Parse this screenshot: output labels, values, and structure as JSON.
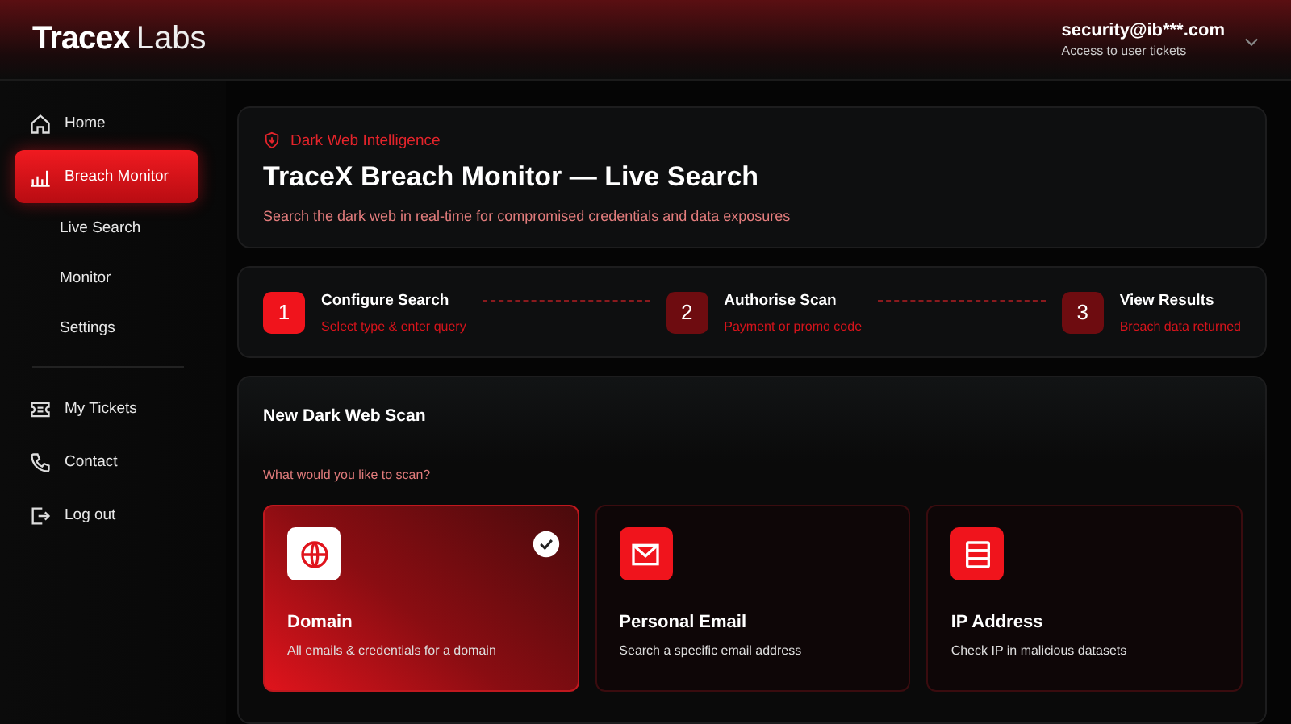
{
  "header": {
    "logo": {
      "brand": "Tracex",
      "suffix": "Labs"
    },
    "user": {
      "email": "security@ib***.com",
      "subtitle": "Access to user tickets"
    }
  },
  "sidebar": {
    "items": [
      {
        "label": "Home",
        "kind": "item",
        "selected": false
      },
      {
        "label": "Breach Monitor",
        "kind": "item",
        "selected": true
      },
      {
        "label": "Live Search",
        "kind": "sub",
        "selected": false
      },
      {
        "label": "Monitor",
        "kind": "sub",
        "selected": false
      },
      {
        "label": "Settings",
        "kind": "sub",
        "selected": false
      },
      {
        "kind": "divider"
      },
      {
        "label": "My Tickets",
        "kind": "item",
        "selected": false
      },
      {
        "label": "Contact",
        "kind": "item",
        "selected": false
      },
      {
        "label": "Log out",
        "kind": "item",
        "selected": false
      }
    ]
  },
  "intro": {
    "eyebrow": "Dark Web Intelligence",
    "title": "TraceX Breach Monitor — Live Search",
    "subtitle": "Search the dark web in real-time for compromised credentials and data exposures"
  },
  "steps": [
    {
      "number": "1",
      "title": "Configure Search",
      "subtitle": "Select type & enter query",
      "active": true
    },
    {
      "number": "2",
      "title": "Authorise Scan",
      "subtitle": "Payment or promo code",
      "active": false
    },
    {
      "number": "3",
      "title": "View Results",
      "subtitle": "Breach data returned",
      "active": false
    }
  ],
  "scan": {
    "title": "New Dark Web Scan",
    "question": "What would you like to scan?",
    "options": [
      {
        "title": "Domain",
        "description": "All emails & credentials for a domain",
        "selected": true
      },
      {
        "title": "Personal Email",
        "description": "Search a specific email address",
        "selected": false
      },
      {
        "title": "IP Address",
        "description": "Check IP in malicious datasets",
        "selected": false
      }
    ]
  }
}
